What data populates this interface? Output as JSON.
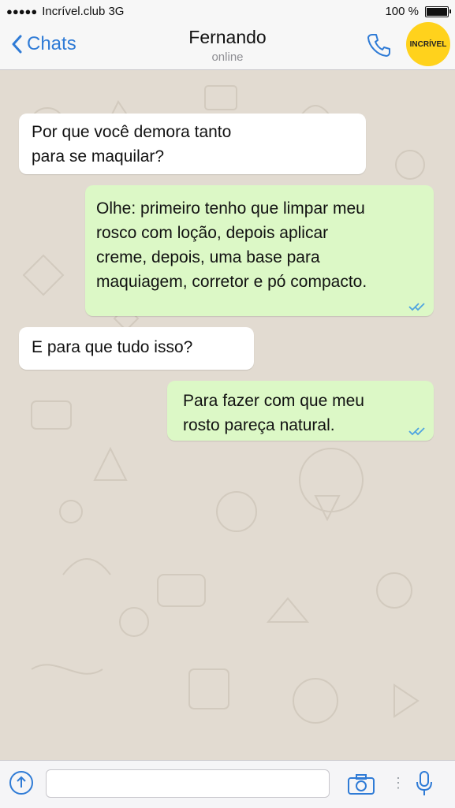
{
  "status_bar": {
    "signal_dots": "●●●●●",
    "carrier": "Incrível.club 3G",
    "battery_text": "100 %"
  },
  "header": {
    "back_label": "Chats",
    "contact_name": "Fernando",
    "contact_status": "online",
    "logo_text": "INCRÍVEL",
    "icons": [
      "back-chevron-icon",
      "phone-icon"
    ]
  },
  "messages": [
    {
      "direction": "incoming",
      "text": "Por que você demora tanto\npara se maquilar?"
    },
    {
      "direction": "outgoing",
      "text": "Olhe: primeiro tenho que limpar meu\nrosco com loção, depois aplicar\ncreme, depois, uma base para\nmaquiagem, corretor e pó compacto.",
      "read": true
    },
    {
      "direction": "incoming",
      "text": "E para que tudo isso?"
    },
    {
      "direction": "outgoing",
      "text": "Para fazer com que meu\nrosto pareça natural.",
      "read": true
    }
  ],
  "input_bar": {
    "placeholder": "",
    "icons": [
      "upload-icon",
      "camera-icon",
      "microphone-icon"
    ]
  },
  "colors": {
    "accent": "#2f7bd6",
    "outgoing_bubble": "#dcf8c6",
    "incoming_bubble": "#ffffff",
    "wallpaper": "#e2dbd1",
    "logo": "#ffd21c"
  }
}
